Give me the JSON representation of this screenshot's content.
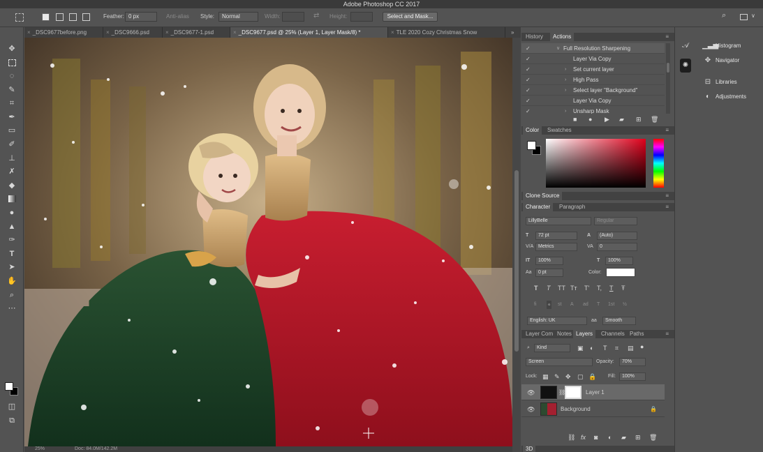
{
  "app": {
    "title": "Adobe Photoshop CC 2017"
  },
  "options_bar": {
    "feather_label": "Feather:",
    "feather_value": "0 px",
    "antialias_label": "Anti-alias",
    "style_label": "Style:",
    "style_value": "Normal",
    "width_label": "Width:",
    "height_label": "Height:",
    "select_mask_button": "Select and Mask..."
  },
  "doc_tabs": [
    {
      "label": "_DSC9677before.png"
    },
    {
      "label": "_DSC9666.psd"
    },
    {
      "label": "_DSC9677-1.psd"
    },
    {
      "label": "_DSC9677.psd @ 25% (Layer 1, Layer Mask/8) *"
    },
    {
      "label": "TLE 2020 Cozy Christmas Snow"
    }
  ],
  "status_bar": {
    "zoom": "25%",
    "doc": "Doc: 84.0M/142.2M"
  },
  "history_panel": {
    "tabs": [
      "History",
      "Actions"
    ],
    "active_tab": "Actions",
    "items": [
      {
        "label": "Full Resolution Sharpening",
        "expand": "∨"
      },
      {
        "label": "Layer Via Copy",
        "expand": ""
      },
      {
        "label": "Set current layer",
        "expand": "›"
      },
      {
        "label": "High Pass",
        "expand": "›"
      },
      {
        "label": "Select layer \"Background\"",
        "expand": "›"
      },
      {
        "label": "Layer Via Copy",
        "expand": ""
      },
      {
        "label": "Unsharp Mask",
        "expand": "›"
      }
    ]
  },
  "color_panel": {
    "tabs": [
      "Color",
      "Swatches"
    ],
    "active_tab": "Color",
    "hue_color": "#e0001b"
  },
  "clone_source": {
    "title": "Clone Source"
  },
  "character_panel": {
    "tabs": [
      "Character",
      "Paragraph"
    ],
    "active_tab": "Character",
    "font_family": "LillyBelle",
    "font_style": "Regular",
    "font_size": "72 pt",
    "leading": "(Auto)",
    "kerning": "Metrics",
    "tracking": "0",
    "vertical_scale": "100%",
    "horizontal_scale": "100%",
    "baseline_shift": "0 pt",
    "color_label": "Color:",
    "style_glyphs": [
      "T",
      "T",
      "TT",
      "Tт",
      "T'",
      "T,",
      "T",
      "Ŧ"
    ],
    "opentype_glyphs": [
      "fi",
      "ℴ",
      "st",
      "A",
      "ad",
      "T",
      "1st",
      "½"
    ],
    "language": "English: UK",
    "aa_label": "aa",
    "antialias": "Smooth"
  },
  "layers_panel": {
    "tabs": [
      "Layer Com",
      "Notes",
      "Layers",
      "Channels",
      "Paths"
    ],
    "active_tab": "Layers",
    "filter_kind": "Kind",
    "blend_mode": "Screen",
    "opacity_label": "Opacity:",
    "opacity": "70%",
    "lock_label": "Lock:",
    "fill_label": "Fill:",
    "fill": "100%",
    "layers": [
      {
        "name": "Layer 1",
        "selected": true
      },
      {
        "name": "Background",
        "selected": false
      }
    ],
    "footer_icons": [
      "link-icon",
      "fx-icon",
      "mask-icon",
      "adjustment-icon",
      "group-icon",
      "new-layer-icon",
      "trash-icon"
    ]
  },
  "right_strip": {
    "items": [
      {
        "label": "Histogram",
        "icon": "histogram-icon"
      },
      {
        "label": "Navigator",
        "icon": "navigator-icon"
      },
      {
        "label": "Libraries",
        "icon": "libraries-icon"
      },
      {
        "label": "Adjustments",
        "icon": "adjustments-icon"
      }
    ]
  },
  "bottom_panel": {
    "label": "3D"
  },
  "colors": {
    "ui_bg": "#535353",
    "panel_header": "#424242",
    "dress_red": "#c0182c",
    "dress_green": "#1f3d27",
    "sequin_gold": "#c9a06a"
  }
}
